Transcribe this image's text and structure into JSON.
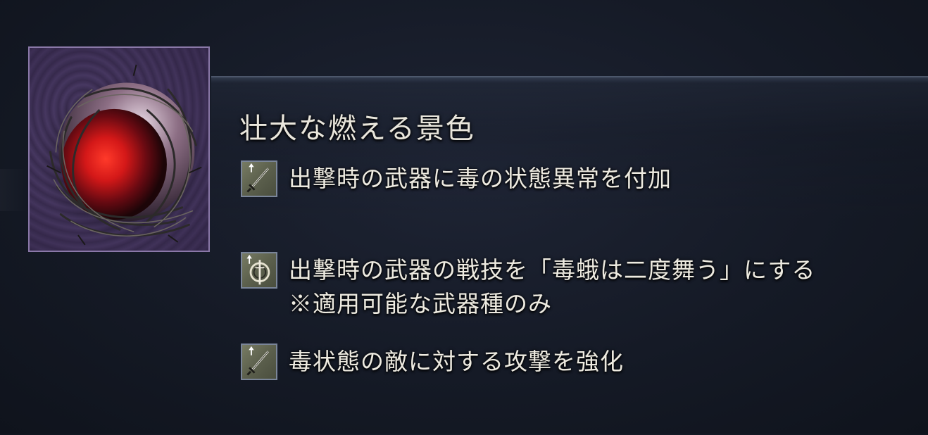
{
  "item": {
    "name": "壮大な燃える景色",
    "icon": "red-orb-in-thorns-icon"
  },
  "effects": [
    {
      "icon": "sword-up-arrow-icon",
      "lines": [
        "出撃時の武器に毒の状態異常を付加"
      ]
    },
    {
      "icon": "ash-of-war-up-arrow-icon",
      "lines": [
        "出撃時の武器の戦技を「毒蛾は二度舞う」にする",
        "※適用可能な武器種のみ"
      ]
    },
    {
      "icon": "sword-up-arrow-icon",
      "lines": [
        "毒状態の敵に対する攻撃を強化"
      ]
    }
  ],
  "colors": {
    "frame_border": "#8a78a8",
    "frame_bg": "#3e3055",
    "orb": "#d22020",
    "text": "#eeebe1",
    "icon_bg": "#6a6e58"
  }
}
